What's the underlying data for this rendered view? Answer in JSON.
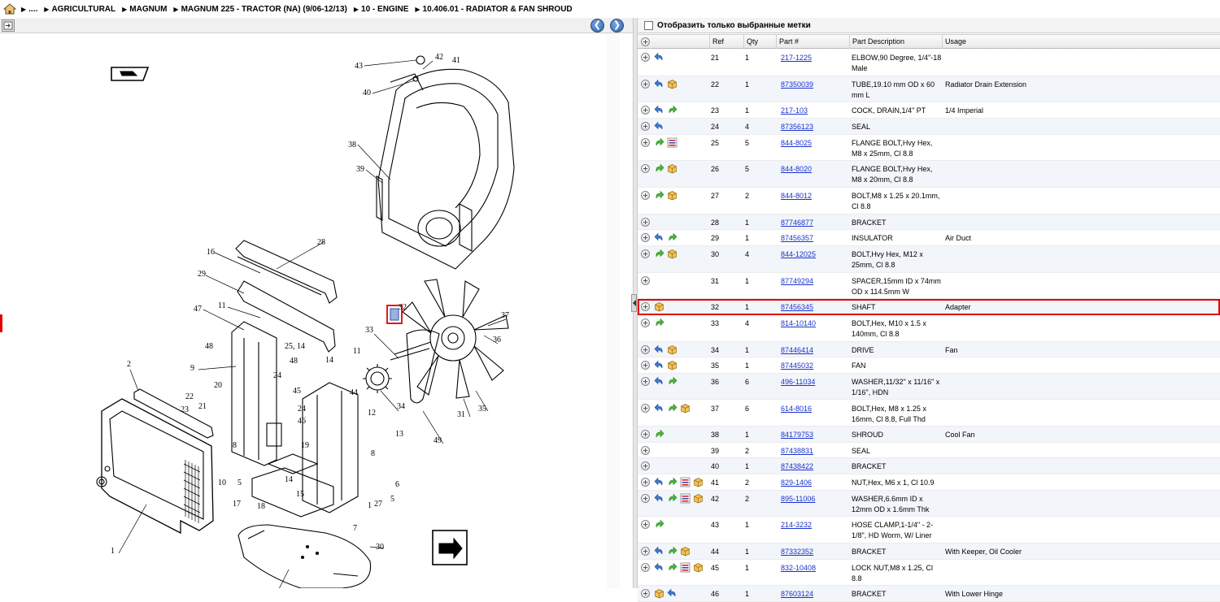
{
  "breadcrumb": {
    "items": [
      "....",
      "AGRICULTURAL",
      "MAGNUM",
      "MAGNUM 225 - TRACTOR (NA) (9/06-12/13)",
      "10 - ENGINE",
      "10.406.01 - RADIATOR & FAN SHROUD"
    ]
  },
  "toolbar": {
    "back_icon": "arrow-left-icon",
    "forward_icon": "arrow-right-icon"
  },
  "filter": {
    "label": "Отобразить только выбранные метки",
    "checked": false
  },
  "table": {
    "columns": [
      "Ref",
      "Qty",
      "Part #",
      "Part Description",
      "Usage"
    ],
    "rows": [
      {
        "ref": "21",
        "qty": "1",
        "part": "217-1225",
        "desc": "ELBOW,90 Degree, 1/4\"-18 Male",
        "usage": "",
        "icons": [
          "back"
        ]
      },
      {
        "ref": "22",
        "qty": "1",
        "part": "87350039",
        "desc": "TUBE,19.10 mm OD x 60 mm L",
        "usage": "Radiator Drain Extension",
        "icons": [
          "back",
          "box"
        ]
      },
      {
        "ref": "23",
        "qty": "1",
        "part": "217-103",
        "desc": "COCK, DRAIN,1/4\" PT",
        "usage": "1/4 Imperial",
        "icons": [
          "back",
          "fwd"
        ]
      },
      {
        "ref": "24",
        "qty": "4",
        "part": "87356123",
        "desc": "SEAL",
        "usage": "",
        "icons": [
          "back"
        ]
      },
      {
        "ref": "25",
        "qty": "5",
        "part": "844-8025",
        "desc": "FLANGE BOLT,Hvy Hex, M8 x 25mm, Cl 8.8",
        "usage": "",
        "icons": [
          "fwd",
          "list"
        ]
      },
      {
        "ref": "26",
        "qty": "5",
        "part": "844-8020",
        "desc": "FLANGE BOLT,Hvy Hex, M8 x 20mm, Cl 8.8",
        "usage": "",
        "icons": [
          "fwd",
          "box"
        ]
      },
      {
        "ref": "27",
        "qty": "2",
        "part": "844-8012",
        "desc": "BOLT,M8 x 1.25 x 20.1mm, Cl 8.8",
        "usage": "",
        "icons": [
          "fwd",
          "box"
        ]
      },
      {
        "ref": "28",
        "qty": "1",
        "part": "87746877",
        "desc": "BRACKET",
        "usage": "",
        "icons": []
      },
      {
        "ref": "29",
        "qty": "1",
        "part": "87456357",
        "desc": "INSULATOR",
        "usage": "Air Duct",
        "icons": [
          "back",
          "fwd"
        ]
      },
      {
        "ref": "30",
        "qty": "4",
        "part": "844-12025",
        "desc": "BOLT,Hvy Hex, M12 x 25mm, Cl 8.8",
        "usage": "",
        "icons": [
          "fwd",
          "box"
        ]
      },
      {
        "ref": "31",
        "qty": "1",
        "part": "87749294",
        "desc": "SPACER,15mm ID x 74mm OD x 114.5mm W",
        "usage": "",
        "icons": []
      },
      {
        "ref": "32",
        "qty": "1",
        "part": "87456345",
        "desc": "SHAFT",
        "usage": "Adapter",
        "icons": [
          "box"
        ],
        "selected": true
      },
      {
        "ref": "33",
        "qty": "4",
        "part": "814-10140",
        "desc": "BOLT,Hex, M10 x 1.5 x 140mm, Cl 8.8",
        "usage": "",
        "icons": [
          "fwd"
        ]
      },
      {
        "ref": "34",
        "qty": "1",
        "part": "87446414",
        "desc": "DRIVE",
        "usage": "Fan",
        "icons": [
          "back",
          "box"
        ]
      },
      {
        "ref": "35",
        "qty": "1",
        "part": "87445032",
        "desc": "FAN",
        "usage": "",
        "icons": [
          "back",
          "box"
        ]
      },
      {
        "ref": "36",
        "qty": "6",
        "part": "496-11034",
        "desc": "WASHER,11/32\" x 11/16\" x 1/16\", HDN",
        "usage": "",
        "icons": [
          "back",
          "fwd"
        ]
      },
      {
        "ref": "37",
        "qty": "6",
        "part": "614-8016",
        "desc": "BOLT,Hex, M8 x 1.25 x 16mm, Cl 8.8, Full Thd",
        "usage": "",
        "icons": [
          "back",
          "fwd",
          "box"
        ]
      },
      {
        "ref": "38",
        "qty": "1",
        "part": "84179753",
        "desc": "SHROUD",
        "usage": "Cool Fan",
        "icons": [
          "fwd"
        ]
      },
      {
        "ref": "39",
        "qty": "2",
        "part": "87438831",
        "desc": "SEAL",
        "usage": "",
        "icons": []
      },
      {
        "ref": "40",
        "qty": "1",
        "part": "87438422",
        "desc": "BRACKET",
        "usage": "",
        "icons": []
      },
      {
        "ref": "41",
        "qty": "2",
        "part": "829-1406",
        "desc": "NUT,Hex, M6 x 1, Cl 10.9",
        "usage": "",
        "icons": [
          "back",
          "fwd",
          "list",
          "box"
        ]
      },
      {
        "ref": "42",
        "qty": "2",
        "part": "895-11006",
        "desc": "WASHER,6.6mm ID x 12mm OD x 1.6mm Thk",
        "usage": "",
        "icons": [
          "back",
          "fwd",
          "list",
          "box"
        ]
      },
      {
        "ref": "43",
        "qty": "1",
        "part": "214-3232",
        "desc": "HOSE CLAMP,1-1/4\" - 2-1/8\", HD Worm, W/ Liner",
        "usage": "",
        "icons": [
          "fwd"
        ]
      },
      {
        "ref": "44",
        "qty": "1",
        "part": "87332352",
        "desc": "BRACKET",
        "usage": "With Keeper, Oil Cooler",
        "icons": [
          "back",
          "fwd",
          "box"
        ]
      },
      {
        "ref": "45",
        "qty": "1",
        "part": "832-10408",
        "desc": "LOCK NUT,M8 x 1.25, Cl 8.8",
        "usage": "",
        "icons": [
          "back",
          "fwd",
          "list",
          "box"
        ]
      },
      {
        "ref": "46",
        "qty": "1",
        "part": "87603124",
        "desc": "BRACKET",
        "usage": "With Lower Hinge",
        "icons": [
          "box",
          "back"
        ]
      }
    ]
  },
  "diagram": {
    "callouts": [
      "43",
      "42",
      "41",
      "40",
      "38",
      "39",
      "28",
      "16",
      "29",
      "47",
      "11",
      "48",
      "9",
      "25, 14",
      "48",
      "24",
      "45",
      "46",
      "24",
      "11",
      "14",
      "44",
      "12",
      "13",
      "2",
      "22",
      "21",
      "20",
      "23",
      "8",
      "10",
      "17",
      "5",
      "19",
      "15",
      "14",
      "18",
      "27",
      "7",
      "1",
      "6",
      "5",
      "8",
      "3",
      "30",
      "33",
      "34",
      "32",
      "37",
      "36",
      "35",
      "31",
      "49",
      "1"
    ]
  }
}
